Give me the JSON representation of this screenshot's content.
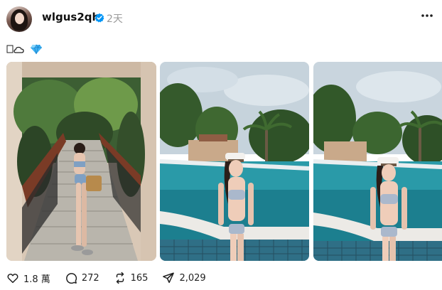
{
  "post": {
    "username": "wlgus2qh",
    "time": "2天",
    "caption_emoji": [
      "cloud-icon",
      "gem-icon"
    ],
    "verified_color": "#0095f6"
  },
  "photos": [
    {
      "scene": "stairs-tropical-garden"
    },
    {
      "scene": "pool-palms"
    },
    {
      "scene": "pool-palms-closeup"
    }
  ],
  "actions": {
    "likes": "1.8 萬",
    "comments": "272",
    "reposts": "165",
    "shares": "2,029"
  }
}
